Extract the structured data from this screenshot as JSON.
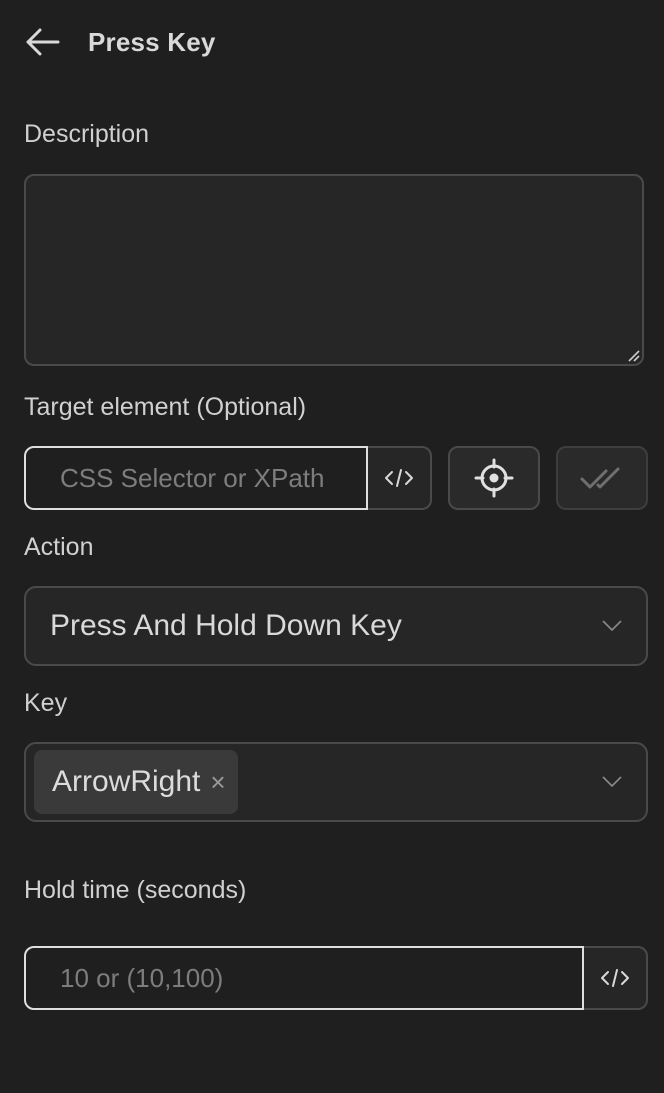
{
  "header": {
    "title": "Press Key",
    "back_icon": "arrow-left-icon"
  },
  "description": {
    "label": "Description",
    "value": ""
  },
  "target": {
    "label": "Target element (Optional)",
    "placeholder": "CSS Selector or XPath",
    "code_icon": "code-icon",
    "pick_icon": "crosshair-icon",
    "verify_icon": "double-check-icon"
  },
  "action": {
    "label": "Action",
    "selected": "Press And Hold Down Key",
    "chevron_icon": "chevron-down-icon"
  },
  "key": {
    "label": "Key",
    "tags": [
      "ArrowRight"
    ],
    "tag_close": "×",
    "chevron_icon": "chevron-down-icon"
  },
  "hold_time": {
    "label": "Hold time (seconds)",
    "placeholder": "10 or (10,100)",
    "code_icon": "code-icon"
  },
  "colors": {
    "background": "#1f1f1f",
    "field": "#262626",
    "border": "#4a4a4a",
    "focus_border": "#dedede"
  }
}
